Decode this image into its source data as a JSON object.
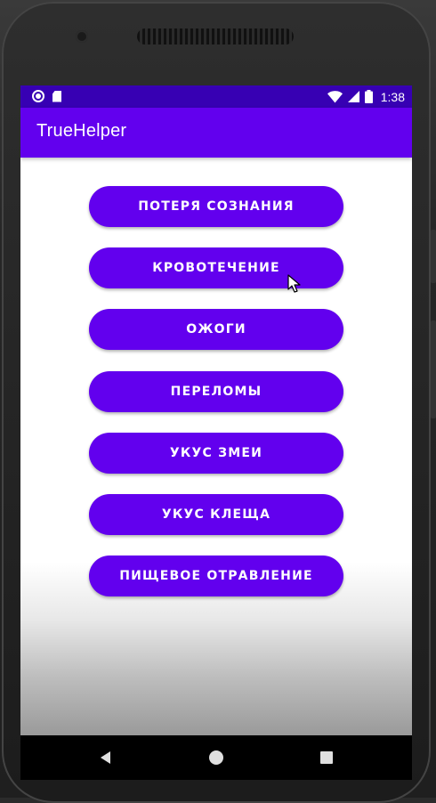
{
  "status_bar": {
    "time": "1:38",
    "icons": [
      "circle-icon",
      "sd-card-icon",
      "wifi-icon",
      "signal-icon",
      "battery-icon"
    ]
  },
  "app_bar": {
    "title": "TrueHelper"
  },
  "buttons": [
    "ПОТЕРЯ СОЗНАНИЯ",
    "КРОВОТЕЧЕНИЕ",
    "ОЖОГИ",
    "ПЕРЕЛОМЫ",
    "УКУС ЗМЕИ",
    "УКУС КЛЕЩА",
    "ПИЩЕВОЕ ОТРАВЛЕНИЕ"
  ],
  "nav_bar": {
    "icons": [
      "back-icon",
      "home-icon",
      "recents-icon"
    ]
  },
  "colors": {
    "primary": "#6200ee",
    "primary_dark": "#3700b3"
  }
}
